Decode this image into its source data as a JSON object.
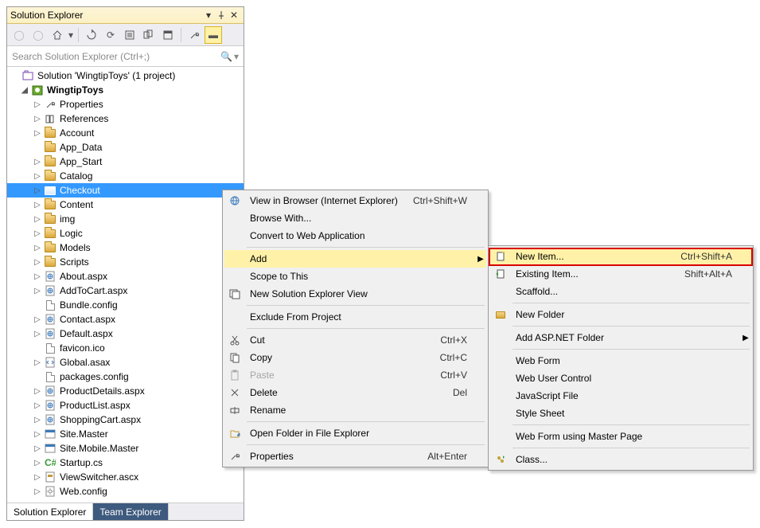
{
  "panel": {
    "title": "Solution Explorer",
    "search_placeholder": "Search Solution Explorer (Ctrl+;)"
  },
  "tree": {
    "solution": "Solution 'WingtipToys' (1 project)",
    "project": "WingtipToys",
    "items": [
      {
        "label": "Properties",
        "icon": "wrench",
        "exp": ">"
      },
      {
        "label": "References",
        "icon": "refs",
        "exp": ">"
      },
      {
        "label": "Account",
        "icon": "folder",
        "exp": ">"
      },
      {
        "label": "App_Data",
        "icon": "folder",
        "exp": ""
      },
      {
        "label": "App_Start",
        "icon": "folder",
        "exp": ">"
      },
      {
        "label": "Catalog",
        "icon": "folder",
        "exp": ">"
      },
      {
        "label": "Checkout",
        "icon": "folder",
        "exp": ">",
        "selected": true
      },
      {
        "label": "Content",
        "icon": "folder",
        "exp": ">"
      },
      {
        "label": "img",
        "icon": "folder",
        "exp": ">"
      },
      {
        "label": "Logic",
        "icon": "folder",
        "exp": ">"
      },
      {
        "label": "Models",
        "icon": "folder",
        "exp": ">"
      },
      {
        "label": "Scripts",
        "icon": "folder",
        "exp": ">"
      },
      {
        "label": "About.aspx",
        "icon": "aspx",
        "exp": ">"
      },
      {
        "label": "AddToCart.aspx",
        "icon": "aspx",
        "exp": ">"
      },
      {
        "label": "Bundle.config",
        "icon": "file",
        "exp": ""
      },
      {
        "label": "Contact.aspx",
        "icon": "aspx",
        "exp": ">"
      },
      {
        "label": "Default.aspx",
        "icon": "aspx",
        "exp": ">"
      },
      {
        "label": "favicon.ico",
        "icon": "file",
        "exp": ""
      },
      {
        "label": "Global.asax",
        "icon": "asax",
        "exp": ">"
      },
      {
        "label": "packages.config",
        "icon": "file",
        "exp": ""
      },
      {
        "label": "ProductDetails.aspx",
        "icon": "aspx",
        "exp": ">"
      },
      {
        "label": "ProductList.aspx",
        "icon": "aspx",
        "exp": ">"
      },
      {
        "label": "ShoppingCart.aspx",
        "icon": "aspx",
        "exp": ">"
      },
      {
        "label": "Site.Master",
        "icon": "master",
        "exp": ">"
      },
      {
        "label": "Site.Mobile.Master",
        "icon": "master",
        "exp": ">"
      },
      {
        "label": "Startup.cs",
        "icon": "cs",
        "exp": ">"
      },
      {
        "label": "ViewSwitcher.ascx",
        "icon": "ascx",
        "exp": ">"
      },
      {
        "label": "Web.config",
        "icon": "config",
        "exp": ">"
      }
    ]
  },
  "tabs": {
    "t1": "Solution Explorer",
    "t2": "Team Explorer"
  },
  "menu1": [
    {
      "label": "View in Browser (Internet Explorer)",
      "shortcut": "Ctrl+Shift+W",
      "icon": "globe"
    },
    {
      "label": "Browse With...",
      "shortcut": ""
    },
    {
      "label": "Convert to Web Application",
      "shortcut": ""
    },
    {
      "sep": true
    },
    {
      "label": "Add",
      "shortcut": "",
      "submenu": true,
      "highlight": true
    },
    {
      "label": "Scope to This",
      "shortcut": ""
    },
    {
      "label": "New Solution Explorer View",
      "shortcut": "",
      "icon": "window"
    },
    {
      "sep": true
    },
    {
      "label": "Exclude From Project",
      "shortcut": ""
    },
    {
      "sep": true
    },
    {
      "label": "Cut",
      "shortcut": "Ctrl+X",
      "icon": "cut"
    },
    {
      "label": "Copy",
      "shortcut": "Ctrl+C",
      "icon": "copy"
    },
    {
      "label": "Paste",
      "shortcut": "Ctrl+V",
      "icon": "paste",
      "disabled": true
    },
    {
      "label": "Delete",
      "shortcut": "Del",
      "icon": "delete"
    },
    {
      "label": "Rename",
      "shortcut": "",
      "icon": "rename"
    },
    {
      "sep": true
    },
    {
      "label": "Open Folder in File Explorer",
      "shortcut": "",
      "icon": "openfolder"
    },
    {
      "sep": true
    },
    {
      "label": "Properties",
      "shortcut": "Alt+Enter",
      "icon": "wrench"
    }
  ],
  "menu2": [
    {
      "label": "New Item...",
      "shortcut": "Ctrl+Shift+A",
      "icon": "newitem",
      "highlight": true
    },
    {
      "label": "Existing Item...",
      "shortcut": "Shift+Alt+A",
      "icon": "existitem"
    },
    {
      "label": "Scaffold...",
      "shortcut": ""
    },
    {
      "sep": true
    },
    {
      "label": "New Folder",
      "shortcut": "",
      "icon": "newfolder"
    },
    {
      "sep": true
    },
    {
      "label": "Add ASP.NET Folder",
      "shortcut": "",
      "submenu": true
    },
    {
      "sep": true
    },
    {
      "label": "Web Form",
      "shortcut": ""
    },
    {
      "label": "Web User Control",
      "shortcut": ""
    },
    {
      "label": "JavaScript File",
      "shortcut": ""
    },
    {
      "label": "Style Sheet",
      "shortcut": ""
    },
    {
      "sep": true
    },
    {
      "label": "Web Form using Master Page",
      "shortcut": ""
    },
    {
      "sep": true
    },
    {
      "label": "Class...",
      "shortcut": "",
      "icon": "class"
    }
  ]
}
